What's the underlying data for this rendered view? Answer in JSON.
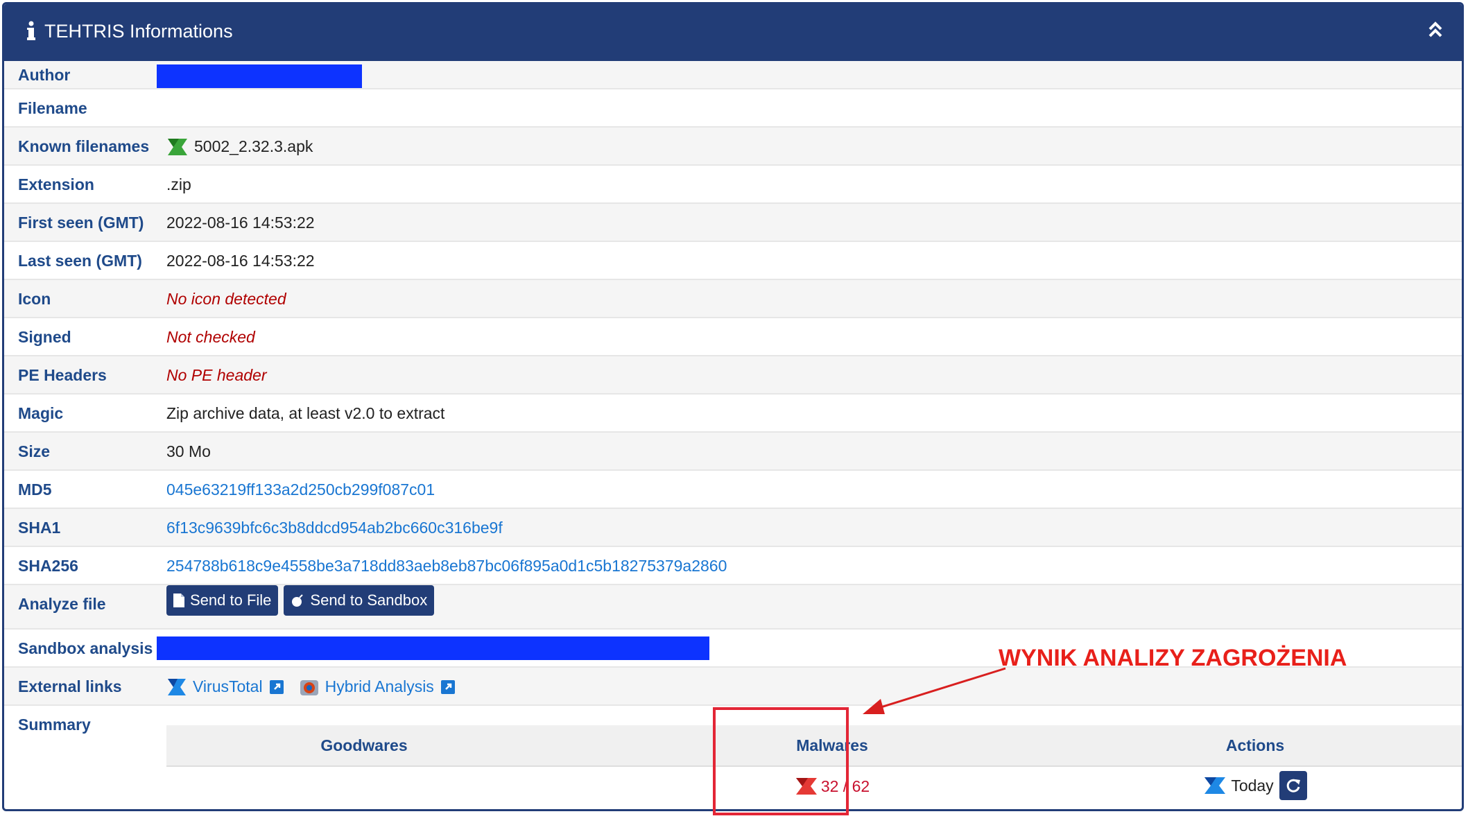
{
  "panel": {
    "title": "TEHTRIS Informations",
    "header_color": "#223d77",
    "icons": {
      "title": "info-icon",
      "collapse": "chevron-double-up-icon"
    }
  },
  "rows": {
    "author": {
      "label": "Author",
      "value_redacted": true
    },
    "filename": {
      "label": "Filename",
      "value": ""
    },
    "known_filenames": {
      "label": "Known filenames",
      "value": "5002_2.32.3.apk",
      "icon": "tehtris-green-logo-icon"
    },
    "extension": {
      "label": "Extension",
      "value": ".zip"
    },
    "first_seen": {
      "label": "First seen (GMT)",
      "value": "2022-08-16 14:53:22"
    },
    "last_seen": {
      "label": "Last seen (GMT)",
      "value": "2022-08-16 14:53:22"
    },
    "icon": {
      "label": "Icon",
      "value": "No icon detected"
    },
    "signed": {
      "label": "Signed",
      "value": "Not checked"
    },
    "pe_headers": {
      "label": "PE Headers",
      "value": "No PE header"
    },
    "magic": {
      "label": "Magic",
      "value": "Zip archive data, at least v2.0 to extract"
    },
    "size": {
      "label": "Size",
      "value": "30 Mo"
    },
    "md5": {
      "label": "MD5",
      "value": "045e63219ff133a2d250cb299f087c01"
    },
    "sha1": {
      "label": "SHA1",
      "value": "6f13c9639bfc6c3b8ddcd954ab2bc660c316be9f"
    },
    "sha256": {
      "label": "SHA256",
      "value": "254788b618c9e4558be3a718dd83aeb8eb87bc06f895a0d1c5b18275379a2860"
    },
    "analyze_file": {
      "label": "Analyze file",
      "send_to_file": "Send to File",
      "send_to_sandbox": "Send to Sandbox"
    },
    "sandbox_analysis": {
      "label": "Sandbox analysis",
      "value_redacted": true
    },
    "external_links": {
      "label": "External links",
      "virustotal": "VirusTotal",
      "hybrid_analysis": "Hybrid Analysis"
    },
    "summary": {
      "label": "Summary"
    }
  },
  "summary_table": {
    "headers": [
      "Goodwares",
      "Malwares",
      "Actions"
    ],
    "goodwares": "",
    "malwares": "32 / 62",
    "actions": "Today"
  },
  "annotation": {
    "text": "WYNIK ANALIZY ZAGROŻENIA",
    "color": "#e8201a"
  },
  "colors": {
    "label": "#1f4a8a",
    "link": "#1976d2",
    "warning": "#b00000",
    "redaction": "#0d33ff",
    "button": "#223d77"
  }
}
